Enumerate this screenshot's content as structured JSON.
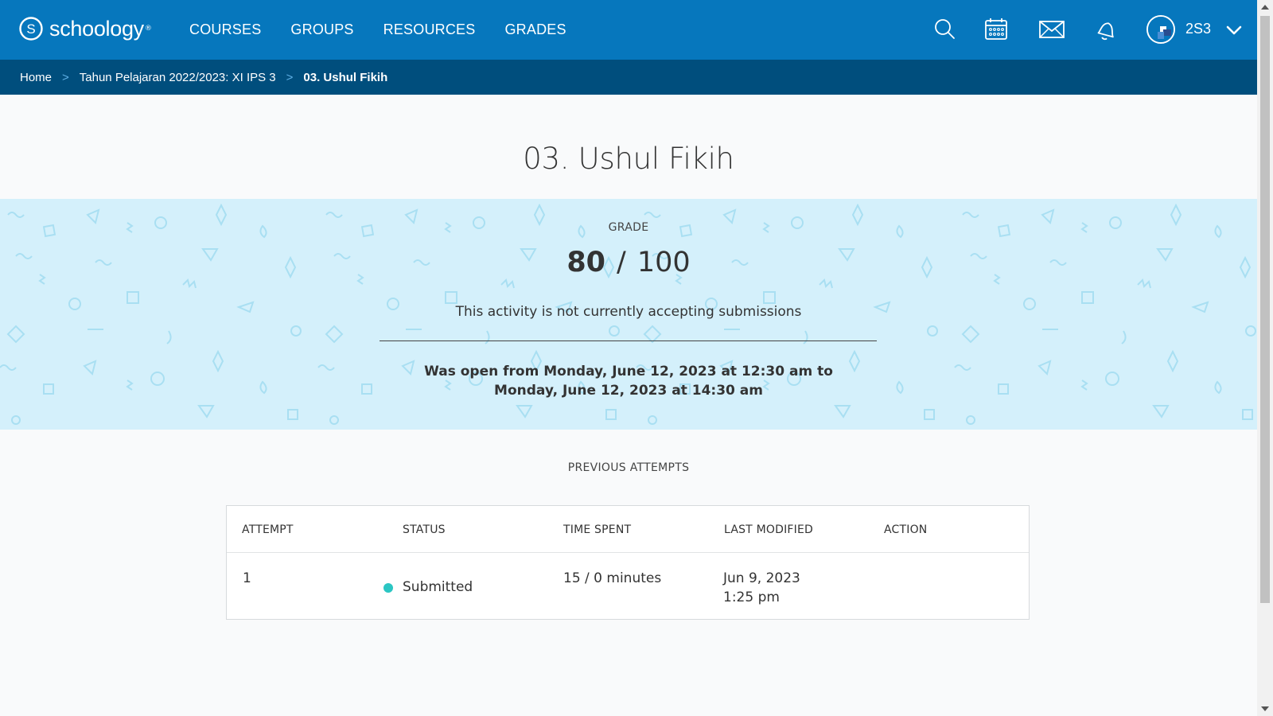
{
  "brand": {
    "name": "schoology",
    "trademark": "®",
    "nav_bg": "#0677bd",
    "breadcrumb_bg": "#004e7d"
  },
  "nav": {
    "links": [
      "COURSES",
      "GROUPS",
      "RESOURCES",
      "GRADES"
    ],
    "icons": [
      "search-icon",
      "calendar-icon",
      "mail-icon",
      "bell-icon"
    ],
    "user_name": "2S3"
  },
  "breadcrumb": {
    "separator": ">",
    "items": [
      "Home",
      "Tahun Pelajaran 2022/2023: XI IPS 3",
      "03. Ushul Fikih"
    ]
  },
  "page": {
    "title": "03. Ushul Fikih"
  },
  "grade": {
    "label": "GRADE",
    "earned": "80",
    "separator": "/",
    "total": "100",
    "note": "This activity is not currently accepting submissions",
    "open_window": "Was open from Monday, June 12, 2023 at 12:30 am to Monday, June 12, 2023 at 14:30 am",
    "band_color": "#d4f0fb"
  },
  "attempts": {
    "heading": "PREVIOUS ATTEMPTS",
    "columns": [
      "ATTEMPT",
      "STATUS",
      "TIME SPENT",
      "LAST MODIFIED",
      "ACTION"
    ],
    "rows": [
      {
        "attempt": "1",
        "status": "Submitted",
        "status_color": "#2bc6c3",
        "time_spent": "15 / 0 minutes",
        "last_modified_date": "Jun 9, 2023",
        "last_modified_time": "1:25 pm",
        "action": ""
      }
    ]
  }
}
